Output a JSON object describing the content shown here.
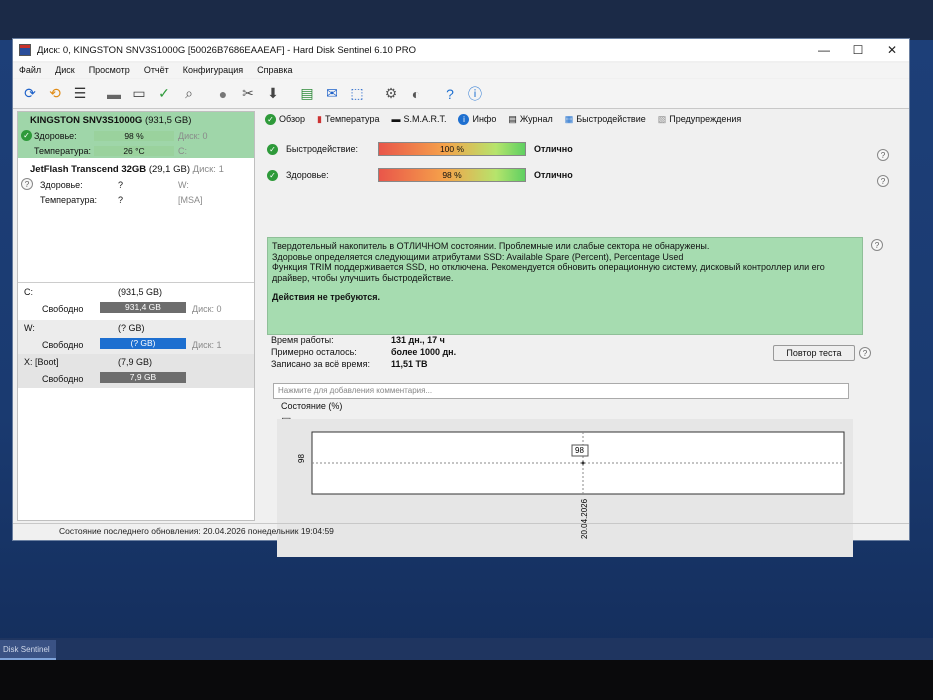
{
  "window": {
    "title": "Диск: 0, KINGSTON SNV3S1000G [50026B7686EAAEAF]  -  Hard Disk Sentinel 6.10 PRO",
    "min": "—",
    "max": "☐",
    "close": "✕"
  },
  "menu": [
    "Файл",
    "Диск",
    "Просмотр",
    "Отчёт",
    "Конфигурация",
    "Справка"
  ],
  "disks": [
    {
      "name": "KINGSTON SNV3S1000G",
      "size": "(931,5 GB)",
      "health_label": "Здоровье:",
      "health": "98 %",
      "health_pct": 98,
      "disk_label": "Диск: 0",
      "temp_label": "Температура:",
      "temp": "26 °C",
      "drive": "C:"
    },
    {
      "name": "JetFlash Transcend 32GB",
      "size": "(29,1 GB)",
      "disk_label": "Диск: 1",
      "health_label": "Здоровье:",
      "health": "?",
      "extra1": "W:",
      "temp_label": "Температура:",
      "temp": "?",
      "extra2": "[MSA]"
    }
  ],
  "volumes": [
    {
      "name": "C:",
      "size": "(931,5 GB)",
      "free_label": "Свободно",
      "free": "931,4 GB",
      "disk": "Диск: 0"
    },
    {
      "name": "W:",
      "size": "(? GB)",
      "free_label": "Свободно",
      "free": "(? GB)",
      "disk": "Диск: 1"
    },
    {
      "name": "X: [Boot]",
      "size": "(7,9 GB)",
      "free_label": "Свободно",
      "free": "7,9 GB",
      "disk": ""
    }
  ],
  "tabs": [
    "Обзор",
    "Температура",
    "S.M.A.R.T.",
    "Инфо",
    "Журнал",
    "Быстродействие",
    "Предупреждения"
  ],
  "performance": {
    "label": "Быстродействие:",
    "value": "100 %",
    "pct": 100,
    "result": "Отлично"
  },
  "health": {
    "label": "Здоровье:",
    "value": "98 %",
    "pct": 98,
    "result": "Отлично"
  },
  "status_text": {
    "line1": "Твердотельный накопитель в ОТЛИЧНОМ состоянии. Проблемные или слабые сектора не обнаружены.",
    "line2": "Здоровье определяется следующими атрибутами SSD: Available Spare (Percent), Percentage Used",
    "line3": "Функция TRIM поддерживается SSD, но отключена. Рекомендуется обновить операционную систему, дисковый контроллер или его драйвер, чтобы улучшить быстродействие.",
    "action": "Действия не требуются."
  },
  "stats": [
    {
      "label": "Время работы:",
      "value": "131 дн., 17 ч"
    },
    {
      "label": "Примерно осталось:",
      "value": "более 1000 дн."
    },
    {
      "label": "Записано за всё время:",
      "value": "11,51 TB"
    }
  ],
  "retest_button": "Повтор теста",
  "comment_placeholder": "Нажмите для добавления комментария...",
  "chart_title": "Состояние (%)",
  "chart_data": {
    "type": "line",
    "x": [
      "20.04.2026"
    ],
    "values": [
      98
    ],
    "ylabel_tick": "98",
    "point_label": "98"
  },
  "statusbar": "Состояние последнего обновления: 20.04.2026 понедельник 19:04:59",
  "taskbar_item": "Disk Sentinel"
}
